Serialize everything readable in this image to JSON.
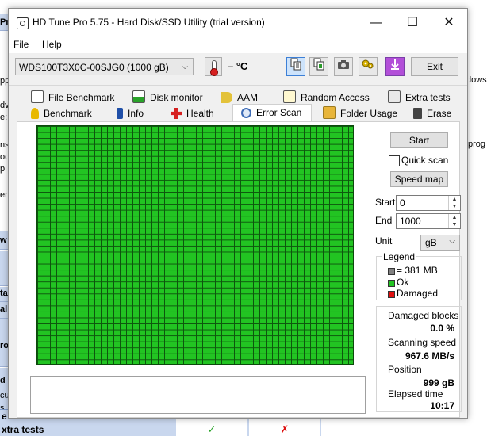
{
  "background": {
    "left_fragments": [
      "Pr",
      "pp",
      "dv",
      "e:",
      "ns",
      "oc",
      "p",
      "ere",
      "w",
      "ta",
      "al",
      "ro",
      "d",
      "cu",
      "s"
    ],
    "right_fragments": [
      "dows",
      "prog"
    ],
    "table_rows": [
      {
        "label": "e benchmark",
        "ok": "✓",
        "no": "✗"
      },
      {
        "label": "xtra tests",
        "ok": "✓",
        "no": "✗"
      }
    ]
  },
  "window": {
    "title": "HD Tune Pro 5.75 - Hard Disk/SSD Utility (trial version)",
    "controls": {
      "minimize": "—",
      "maximize": "☐",
      "close": "✕"
    }
  },
  "menu": {
    "file": "File",
    "help": "Help"
  },
  "toolbar": {
    "drive": "WDS100T3X0C-00SJG0 (1000 gB)",
    "temperature": "– °C",
    "exit_label": "Exit",
    "icons": [
      "copy-text-icon",
      "copy-screenshot-icon",
      "camera-icon",
      "options-icon",
      "save-icon"
    ]
  },
  "tabs": {
    "row1": [
      "File Benchmark",
      "Disk monitor",
      "AAM",
      "Random Access",
      "Extra tests"
    ],
    "row2": [
      "Benchmark",
      "Info",
      "Health",
      "Error Scan",
      "Folder Usage",
      "Erase"
    ],
    "active": "Error Scan"
  },
  "scan": {
    "start_label": "Start",
    "quick_scan_label": "Quick scan",
    "quick_scan_checked": false,
    "speed_map_label": "Speed map",
    "start_field_label": "Start",
    "start_value": "0",
    "end_field_label": "End",
    "end_value": "1000",
    "unit_label": "Unit",
    "unit_value": "gB",
    "legend_title": "Legend",
    "legend_items": [
      {
        "text": "= 381 MB",
        "color": "#808080"
      },
      {
        "text": "Ok",
        "color": "#22c422"
      },
      {
        "text": "Damaged",
        "color": "#e01010"
      }
    ],
    "damaged_blocks_label": "Damaged blocks",
    "damaged_blocks_value": "0.0 %",
    "scanning_speed_label": "Scanning speed",
    "scanning_speed_value": "967.6 MB/s",
    "position_label": "Position",
    "position_value": "999 gB",
    "elapsed_label": "Elapsed time",
    "elapsed_value": "10:17",
    "ok_color": "#22c422"
  }
}
